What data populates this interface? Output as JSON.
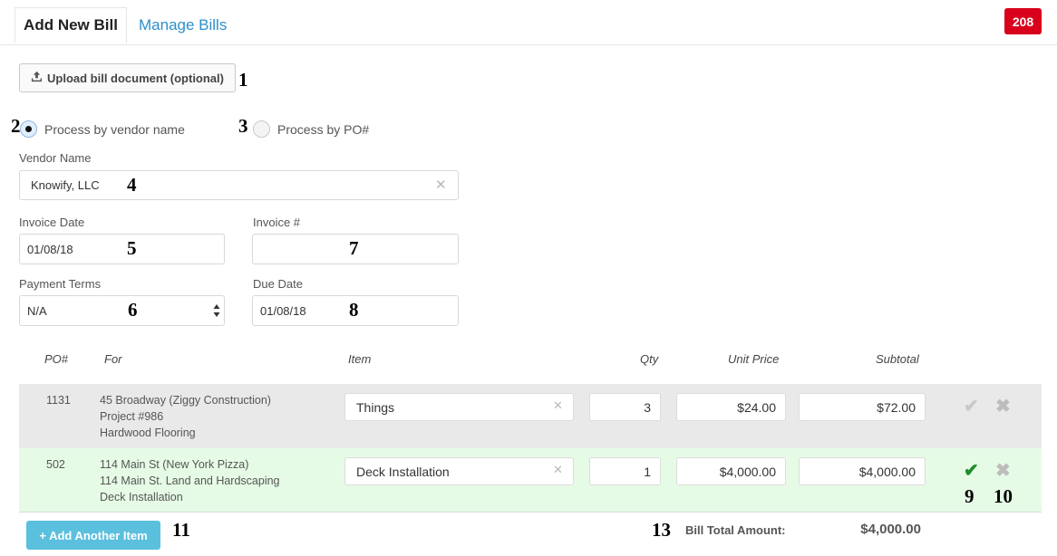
{
  "tabs": {
    "add_new_bill": "Add New Bill",
    "manage_bills": "Manage Bills",
    "badge_count": "208"
  },
  "upload": {
    "label": "Upload bill document (optional)",
    "icon": "upload-icon"
  },
  "process": {
    "by_vendor": "Process by vendor name",
    "by_po": "Process by PO#",
    "selected": "vendor"
  },
  "vendor": {
    "label": "Vendor Name",
    "value": "Knowify, LLC"
  },
  "invoice_date": {
    "label": "Invoice Date",
    "value": "01/08/18"
  },
  "invoice_number": {
    "label": "Invoice #",
    "value": ""
  },
  "payment_terms": {
    "label": "Payment Terms",
    "value": "N/A"
  },
  "due_date": {
    "label": "Due Date",
    "value": "01/08/18"
  },
  "table": {
    "headers": {
      "po": "PO#",
      "for": "For",
      "item": "Item",
      "qty": "Qty",
      "unit_price": "Unit Price",
      "subtotal": "Subtotal"
    },
    "rows": [
      {
        "po": "1131",
        "for_line1": "45 Broadway (Ziggy Construction)",
        "for_line2": "Project #986",
        "for_line3": "Hardwood Flooring",
        "item": "Things",
        "qty": "3",
        "unit_price": "$24.00",
        "subtotal": "$72.00",
        "confirmed": false
      },
      {
        "po": "502",
        "for_line1": "114 Main St (New York Pizza)",
        "for_line2": "114 Main St. Land and Hardscaping",
        "for_line3": "Deck Installation",
        "item": "Deck Installation",
        "qty": "1",
        "unit_price": "$4,000.00",
        "subtotal": "$4,000.00",
        "confirmed": true
      }
    ]
  },
  "footer": {
    "add_item": "+ Add Another Item",
    "total_label": "Bill Total Amount:",
    "total_value": "$4,000.00"
  },
  "annotations": [
    "1",
    "2",
    "3",
    "4",
    "5",
    "6",
    "7",
    "8",
    "9",
    "10",
    "11",
    "13"
  ],
  "colors": {
    "accent_link": "#2f8fc9",
    "badge_red": "#d9001b",
    "confirm_green": "#1e8c2a",
    "add_button": "#5bc0de",
    "row_pending": "#e9e9e9",
    "row_confirmed": "#e6fbe6"
  }
}
